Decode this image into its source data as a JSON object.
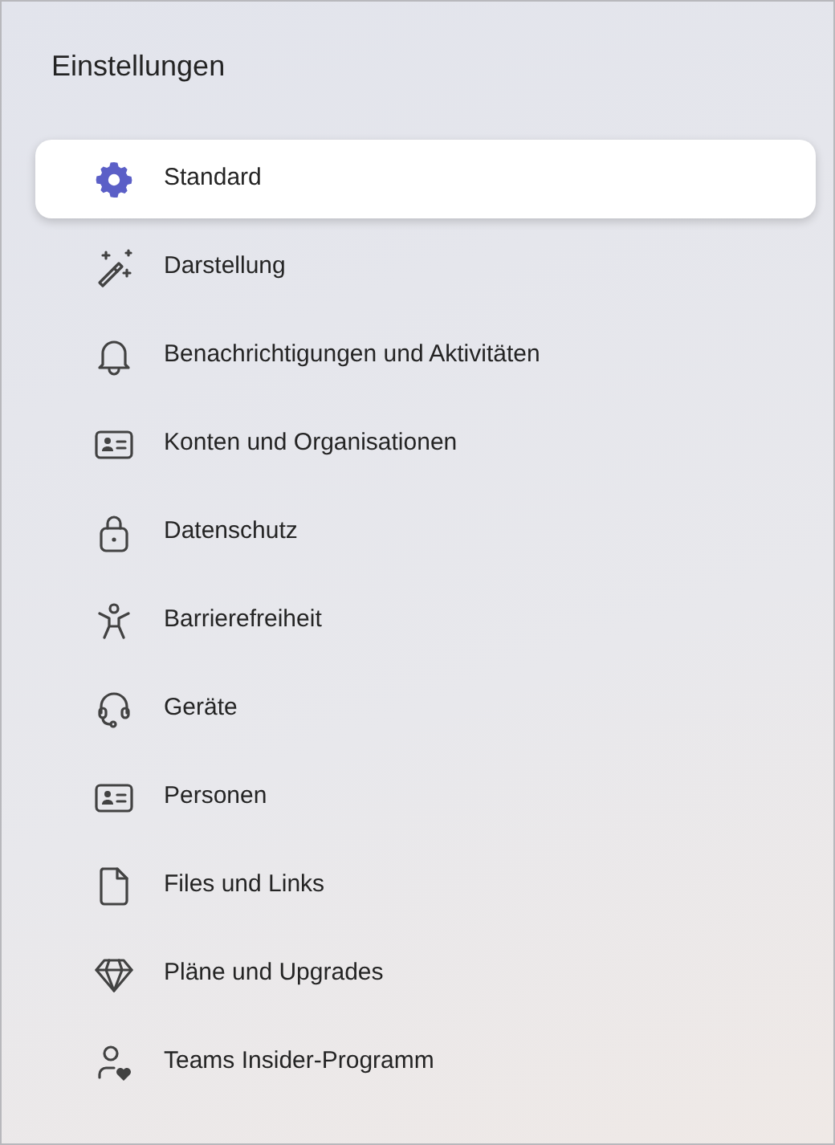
{
  "title": "Einstellungen",
  "items": [
    {
      "label": "Standard",
      "selected": true
    },
    {
      "label": "Darstellung",
      "selected": false
    },
    {
      "label": "Benachrichtigungen und Aktivitäten",
      "selected": false
    },
    {
      "label": "Konten und Organisationen",
      "selected": false
    },
    {
      "label": "Datenschutz",
      "selected": false
    },
    {
      "label": "Barrierefreiheit",
      "selected": false
    },
    {
      "label": "Geräte",
      "selected": false
    },
    {
      "label": "Personen",
      "selected": false
    },
    {
      "label": "Files und Links",
      "selected": false
    },
    {
      "label": "Pläne und Upgrades",
      "selected": false
    },
    {
      "label": "Teams Insider-Programm",
      "selected": false
    }
  ]
}
